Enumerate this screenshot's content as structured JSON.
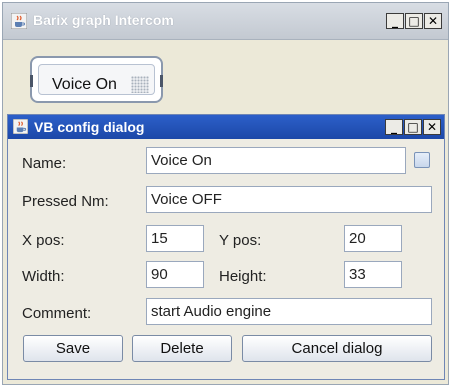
{
  "main_window": {
    "title": "Barix graph Intercom",
    "controls": {
      "minimize": "_",
      "maximize": "□",
      "close": "✕"
    }
  },
  "voice_button": {
    "label": "Voice On"
  },
  "dialog": {
    "title": "VB config dialog",
    "controls": {
      "minimize": "_",
      "maximize": "□",
      "close": "✕"
    },
    "labels": {
      "name": "Name:",
      "pressed_name": "Pressed Nm:",
      "x_pos": "X pos:",
      "y_pos": "Y pos:",
      "width": "Width:",
      "height": "Height:",
      "comment": "Comment:"
    },
    "values": {
      "name": "Voice On",
      "pressed_name": "Voice OFF",
      "x_pos": "15",
      "y_pos": "20",
      "width": "90",
      "height": "33",
      "comment": "start Audio engine"
    },
    "buttons": {
      "save": "Save",
      "delete": "Delete",
      "cancel": "Cancel dialog"
    }
  },
  "icons": [
    "java-cup-icon",
    "checkbox"
  ],
  "colors": {
    "dialog_title_bar": "#2358c0",
    "window_bg": "#ece9d8"
  }
}
